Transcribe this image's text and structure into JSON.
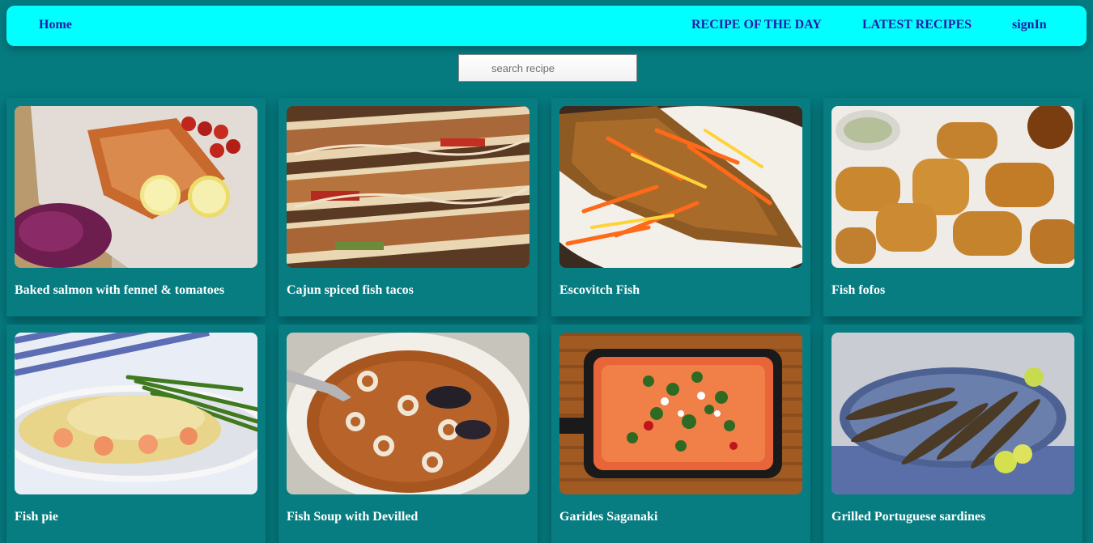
{
  "nav": {
    "home": "Home",
    "recipe_of_the_day": "RECIPE OF THE DAY",
    "latest_recipes": "LATEST RECIPES",
    "sign_in": "signIn"
  },
  "search": {
    "placeholder": "search recipe"
  },
  "recipes": [
    {
      "title": "Baked salmon with fennel & tomatoes",
      "icon": "salmon-image"
    },
    {
      "title": "Cajun spiced fish tacos",
      "icon": "fish-tacos-image"
    },
    {
      "title": "Escovitch Fish",
      "icon": "escovitch-fish-image"
    },
    {
      "title": "Fish fofos",
      "icon": "fish-fofos-image"
    },
    {
      "title": "Fish pie",
      "icon": "fish-pie-image"
    },
    {
      "title": "Fish Soup with Devilled",
      "icon": "fish-soup-image"
    },
    {
      "title": "Garides Saganaki",
      "icon": "garides-saganaki-image"
    },
    {
      "title": "Grilled Portuguese sardines",
      "icon": "grilled-sardines-image"
    }
  ],
  "colors": {
    "background": "#057b80",
    "navbar": "#00ffff",
    "nav_text": "#2a1aa6",
    "card_text": "#ffffff"
  }
}
